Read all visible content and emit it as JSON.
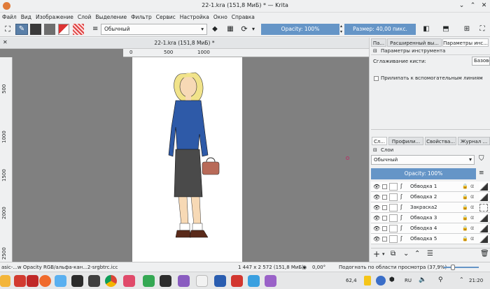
{
  "window": {
    "title": "22-1.kra (151,8 МиБ) * — Krita"
  },
  "menu": [
    "Файл",
    "Вид",
    "Изображение",
    "Слой",
    "Выделение",
    "Фильтр",
    "Сервис",
    "Настройка",
    "Окно",
    "Справка"
  ],
  "toolbar": {
    "blend_mode": "Обычный",
    "opacity_label": "Opacity: 100%",
    "size_label": "Размер: 40,00 пикс."
  },
  "document": {
    "tab_title": "22-1.kra (151,8 МиБ) *",
    "hruler_ticks": [
      "0",
      "500",
      "1000"
    ],
    "vruler_ticks": [
      "500",
      "1000",
      "1500",
      "2000",
      "2500"
    ]
  },
  "tool_options": {
    "tabs": [
      "Па...",
      "Расширенный вы...",
      "Параметры инс..."
    ],
    "header": "Параметры инструмента",
    "smoothing_label": "Сглаживание кисти:",
    "smoothing_value": "Базовое",
    "snap_label": "Прилипать к вспомогательным линиям"
  },
  "docker_tabs": [
    "Сл...",
    "Профили...",
    "Свойства...",
    "Журнал ..."
  ],
  "layers": {
    "title": "Слои",
    "blend_mode": "Обычный",
    "opacity_label": "Opacity: 100%",
    "items": [
      {
        "name": "Обводка 1"
      },
      {
        "name": "Обводка 2"
      },
      {
        "name": "Закраска2"
      },
      {
        "name": "Обводка 3"
      },
      {
        "name": "Обводка 4"
      },
      {
        "name": "Обводка 5"
      }
    ]
  },
  "status": {
    "brush": "asic-...w Opacity",
    "colorspace": "RGB/альфа-кан...2-srgbtrc.icc",
    "image_size": "1 447 x 2 572 (151,8 МиБ)",
    "rotation": "0,00°",
    "zoom_mode": "Подогнать по области просмотра (37,9%)"
  },
  "taskbar": {
    "battery": "62,4",
    "lang": "RU",
    "time": "21:20"
  },
  "colors": {
    "accent": "#6595c7",
    "canvas_bg": "#808080",
    "panel_bg": "#eff0f1"
  }
}
